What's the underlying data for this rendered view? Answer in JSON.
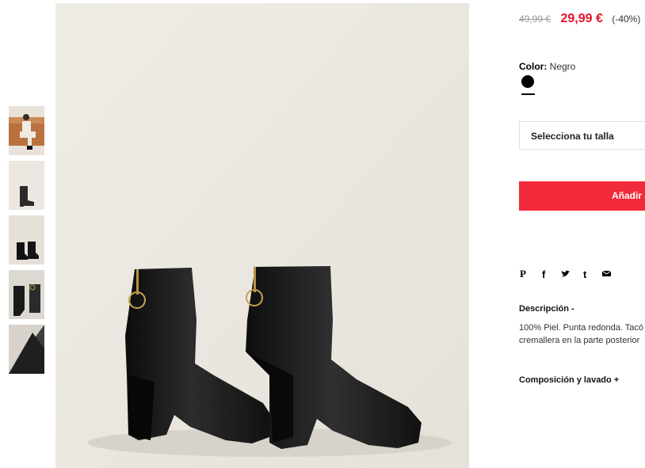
{
  "product": {
    "old_price": "49,99 €",
    "new_price": "29,99 €",
    "discount": "(-40%)",
    "color_label": "Color:",
    "color_value": "Negro",
    "size_placeholder": "Selecciona tu talla",
    "add_to_cart": "Añadir a",
    "description_title": "Descripción -",
    "description_line1": "100% Piel. Punta redonda. Tacó",
    "description_line2": "cremallera en la parte posterior",
    "composition_title": "Composición y lavado +"
  },
  "share_icons": [
    "pinterest-icon",
    "facebook-icon",
    "twitter-icon",
    "tumblr-icon",
    "mail-icon"
  ],
  "colors": {
    "price_red": "#e7112b",
    "button_red": "#f2293a",
    "swatch": "#000000"
  }
}
